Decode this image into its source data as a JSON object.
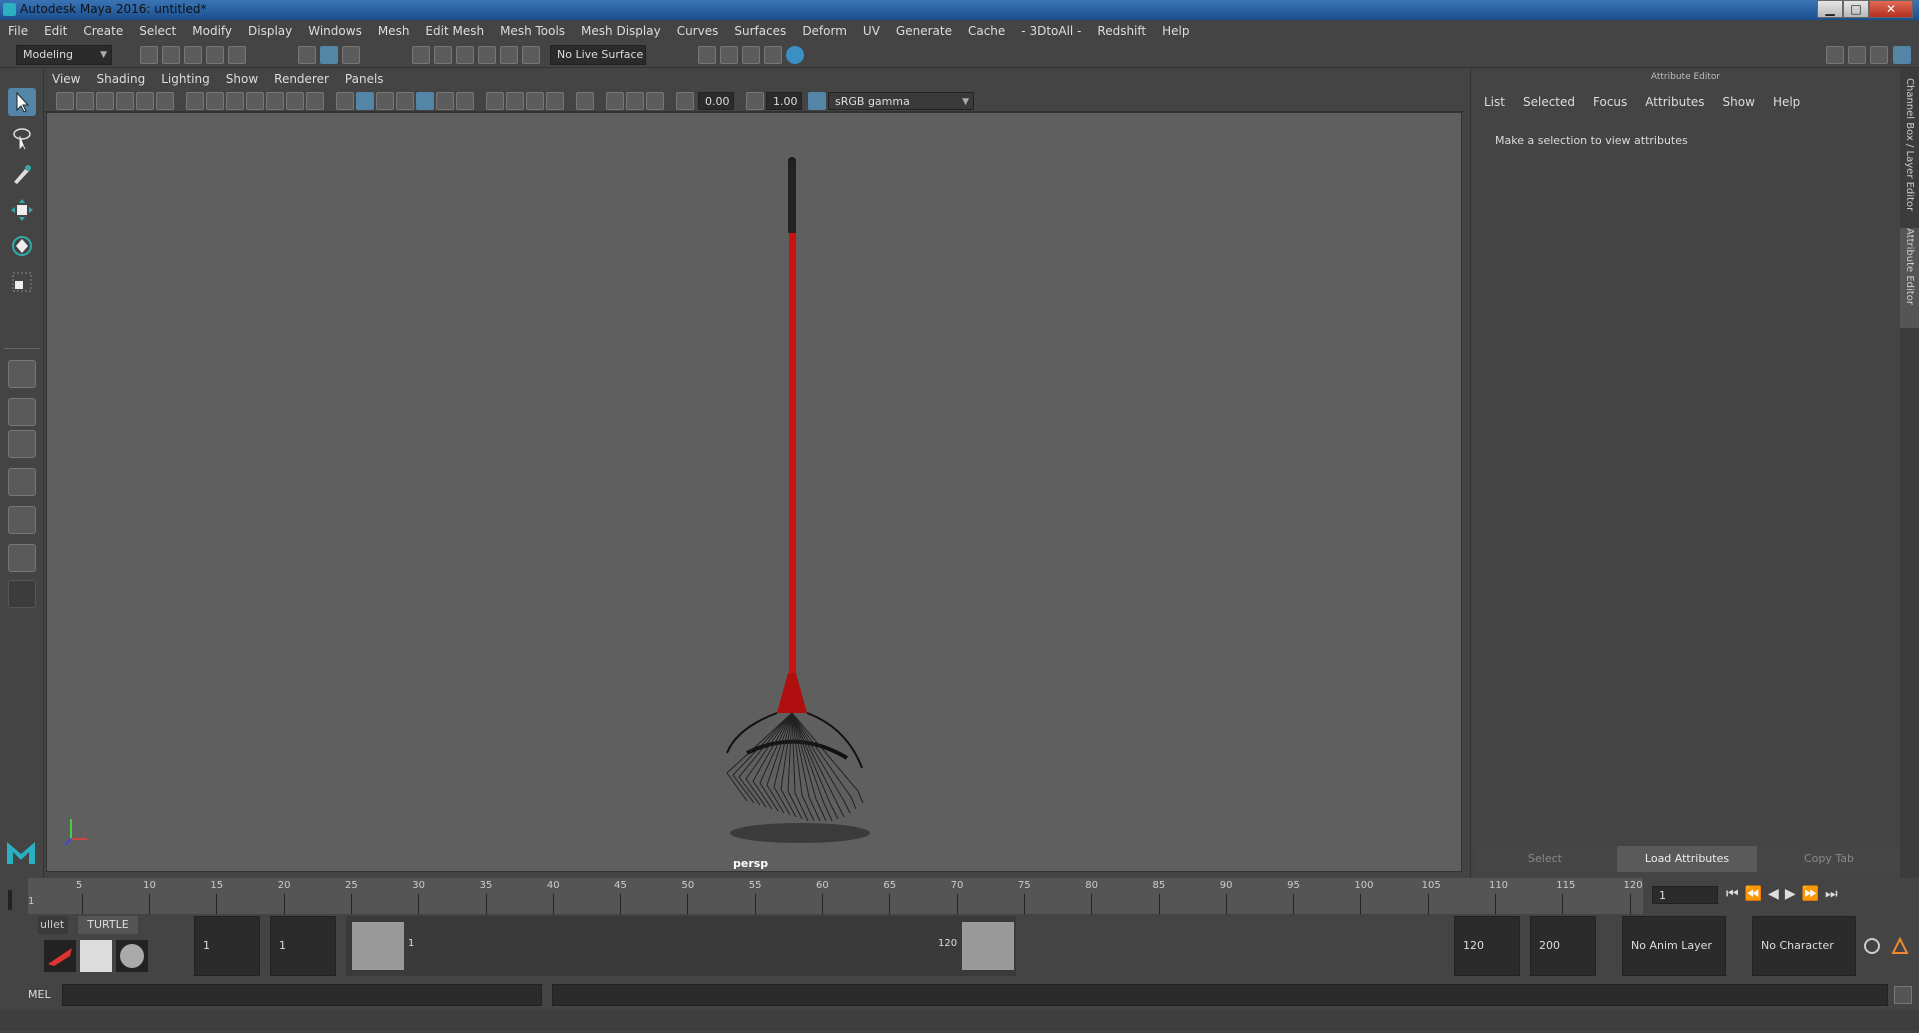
{
  "window": {
    "title": "Autodesk Maya 2016: untitled*",
    "min_label": "▁",
    "max_label": "□",
    "close_label": "✕"
  },
  "menubar": [
    "File",
    "Edit",
    "Create",
    "Select",
    "Modify",
    "Display",
    "Windows",
    "Mesh",
    "Edit Mesh",
    "Mesh Tools",
    "Mesh Display",
    "Curves",
    "Surfaces",
    "Deform",
    "UV",
    "Generate",
    "Cache",
    "- 3DtoAll -",
    "Redshift",
    "Help"
  ],
  "toolbar": {
    "mode": "Modeling",
    "live_surface": "No Live Surface"
  },
  "viewport": {
    "menu": [
      "View",
      "Shading",
      "Lighting",
      "Show",
      "Renderer",
      "Panels"
    ],
    "exposure": "0.00",
    "gamma": "1.00",
    "color_space": "sRGB gamma",
    "camera_label": "persp"
  },
  "attribute_editor": {
    "title": "Attribute Editor",
    "tabs": [
      "List",
      "Selected",
      "Focus",
      "Attributes",
      "Show",
      "Help"
    ],
    "message": "Make a selection to view attributes",
    "buttons": {
      "select": "Select",
      "load": "Load Attributes",
      "copy": "Copy Tab"
    }
  },
  "side_tabs": [
    "Channel Box / Layer Editor",
    "Attribute Editor"
  ],
  "timeline": {
    "ticks": [
      "5",
      "10",
      "15",
      "20",
      "25",
      "30",
      "35",
      "40",
      "45",
      "50",
      "55",
      "60",
      "65",
      "70",
      "75",
      "80",
      "85",
      "90",
      "95",
      "100",
      "105",
      "110",
      "115",
      "120"
    ],
    "start_label": "1",
    "current_frame": "1"
  },
  "range": {
    "shelf_tabs": [
      "ullet",
      "TURTLE"
    ],
    "start": "1",
    "playback_start": "1",
    "slider_start": "1",
    "slider_end": "120",
    "playback_end": "120",
    "end": "200",
    "anim_layer": "No Anim Layer",
    "character_set": "No Character Set"
  },
  "command": {
    "label": "MEL"
  },
  "colors": {
    "viewport_bg": "#5f5f5f",
    "accent": "#5285a6",
    "rake_handle": "#cc1111"
  }
}
